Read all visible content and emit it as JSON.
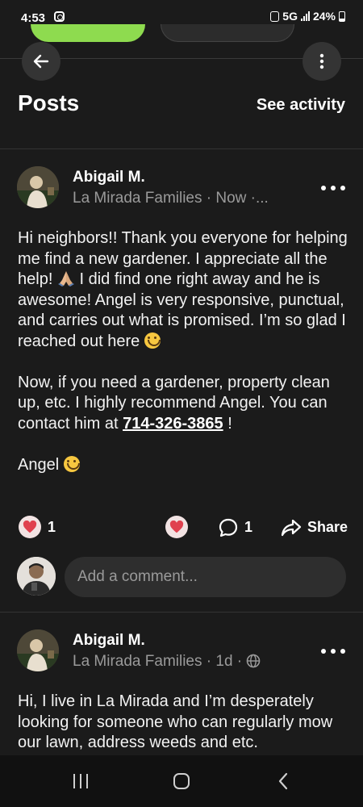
{
  "status_bar": {
    "time": "4:53",
    "network": "5G",
    "battery": "24%"
  },
  "header": {
    "title": "Posts",
    "see_activity": "See activity"
  },
  "posts": [
    {
      "author": "Abigail M.",
      "meta": "La Mirada Families · Now ·...",
      "body": {
        "p1_a": "Hi neighbors!! Thank you everyone for helping me find a new gardener. I appreciate all the help!",
        "p1_b": "I did find one right away and he is awesome! Angel is very responsive, punctual, and carries out what is promised. I’m so glad I reached out here",
        "p2_a": "Now, if you need a gardener, property clean up, etc. I highly recommend Angel. You can contact him at",
        "phone": "714-326-3865",
        "p2_b": "!",
        "p3": "Angel"
      },
      "reactions_count": "1",
      "comments_count": "1",
      "share_label": "Share"
    },
    {
      "author": "Abigail M.",
      "meta": "La Mirada Families · 1d ·",
      "body_text": "Hi, I live in La Mirada and I’m desperately looking for someone who can regularly mow our lawn, address weeds and etc."
    }
  ],
  "comment_input": {
    "placeholder": "Add a comment..."
  },
  "colors": {
    "background": "#1b1b1b",
    "reaction_red": "#e0414f",
    "top_button_green": "#8edb4f"
  },
  "icons": [
    "arrow-left-icon",
    "more-vertical-icon",
    "more-horizontal-icon",
    "heart-icon",
    "comment-icon",
    "share-icon",
    "globe-icon",
    "prayer-hands-icon",
    "smile-icon",
    "nav-recents-icon",
    "nav-home-icon",
    "nav-back-icon"
  ]
}
